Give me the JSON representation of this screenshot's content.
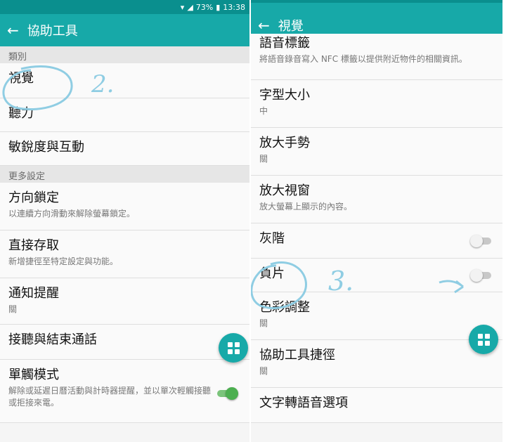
{
  "left": {
    "status_text": "73%",
    "status_time": "13:38",
    "title": "協助工具",
    "sections": [
      {
        "label": "類別"
      },
      {
        "label": "更多設定"
      }
    ],
    "category_items": [
      {
        "title": "視覺"
      },
      {
        "title": "聽力"
      },
      {
        "title": "敏銳度與互動"
      }
    ],
    "more_items": [
      {
        "title": "方向鎖定",
        "subtitle": "以連續方向滑動來解除螢幕鎖定。"
      },
      {
        "title": "直接存取",
        "subtitle": "新增捷徑至特定設定與功能。"
      },
      {
        "title": "通知提醒",
        "subtitle": "關"
      },
      {
        "title": "接聽與結束通話"
      },
      {
        "title": "單觸模式",
        "subtitle": "解除或延遲日曆活動與計時器提醒，並以單次輕觸接聽或拒接來電。",
        "toggle": "on"
      }
    ],
    "annotation": "2."
  },
  "right": {
    "title": "視覺",
    "items": [
      {
        "title": "語音標籤",
        "subtitle": "將語音錄音寫入 NFC 標籤以提供附近物件的相關資訊。"
      },
      {
        "title": "字型大小",
        "subtitle": "中"
      },
      {
        "title": "放大手勢",
        "subtitle": "關"
      },
      {
        "title": "放大視窗",
        "subtitle": "放大螢幕上顯示的內容。"
      },
      {
        "title": "灰階",
        "toggle": "off"
      },
      {
        "title": "負片",
        "toggle": "off"
      },
      {
        "title": "色彩調整",
        "subtitle": "關"
      },
      {
        "title": "協助工具捷徑",
        "subtitle": "關"
      },
      {
        "title": "文字轉語音選項"
      }
    ],
    "annotation": "3."
  },
  "colors": {
    "accent": "#17a9a8",
    "status_bar": "#0a8f8e",
    "annotation": "#8fcde3"
  }
}
